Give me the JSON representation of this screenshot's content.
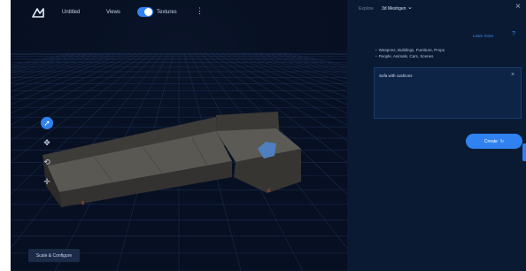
{
  "topbar": {
    "title": "Untitled",
    "view_label": "Views",
    "toggle_label": "Textures",
    "more": "⋮"
  },
  "viewport": {
    "tools": [
      {
        "icon": "cursor-icon",
        "glyph": "➚",
        "active": true
      },
      {
        "icon": "move-icon",
        "glyph": "✥",
        "active": false
      },
      {
        "icon": "rotate-icon",
        "glyph": "⟲",
        "active": false
      },
      {
        "icon": "pan-icon",
        "glyph": "✛",
        "active": false
      }
    ],
    "mode_button_label": "Scale & Configure"
  },
  "panel": {
    "tab_1": "Explore",
    "tab_2": "3d Meshgen",
    "chevron": "⌄",
    "close": "×",
    "link_label": "Learn more",
    "help": "?",
    "list": [
      "Weapons, Buildings, Furniture, Props",
      "People, Animals, Cars, Scenes"
    ],
    "prompt_value": "Sofa with cushions",
    "prompt_clear": "×",
    "create_label": "Create",
    "create_icon": "↻"
  },
  "colors": {
    "accent": "#2f82f0",
    "background": "#050d1c",
    "panel": "#0a1a33",
    "sofa": "#4a4945"
  }
}
